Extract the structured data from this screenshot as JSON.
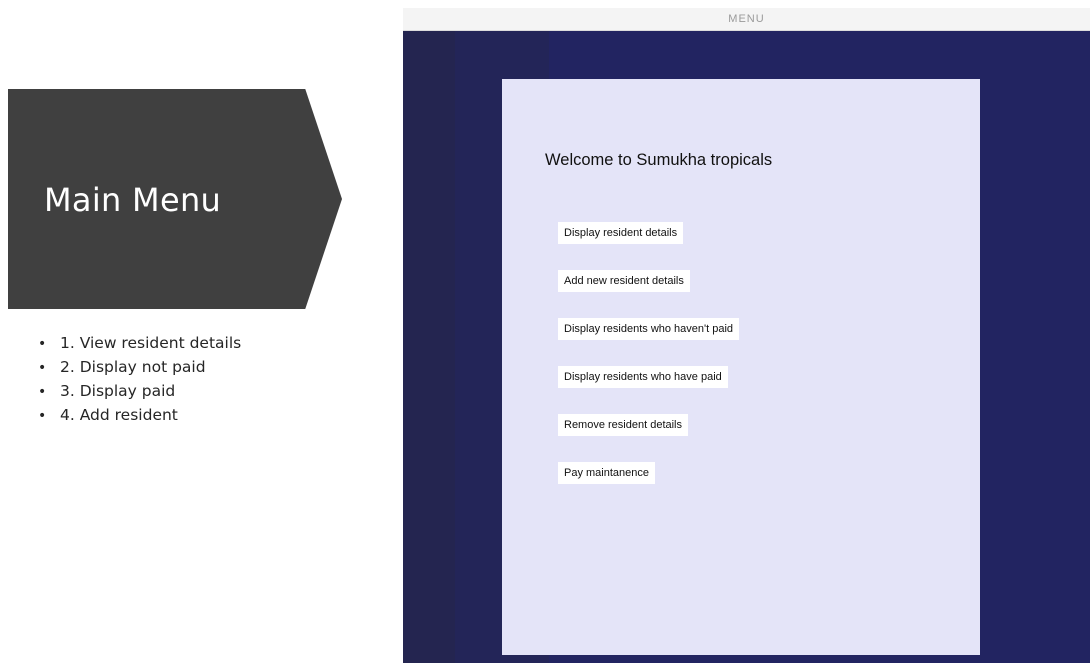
{
  "slide": {
    "title": "Main Menu",
    "bullet_char": "•",
    "items": [
      "1. View resident details",
      "2. Display not paid",
      "3. Display paid",
      "4. Add resident"
    ]
  },
  "window": {
    "title": "MENU"
  },
  "menu": {
    "welcome": "Welcome  to Sumukha tropicals",
    "buttons": [
      "Display resident details",
      "Add new resident details",
      "Display residents who haven't paid",
      "Display residents who have paid",
      "Remove resident details",
      "Pay maintanence"
    ]
  },
  "colors": {
    "banner": "#404040",
    "app_background": "#222461",
    "card": "#e4e4f8",
    "button": "#ffffff"
  }
}
